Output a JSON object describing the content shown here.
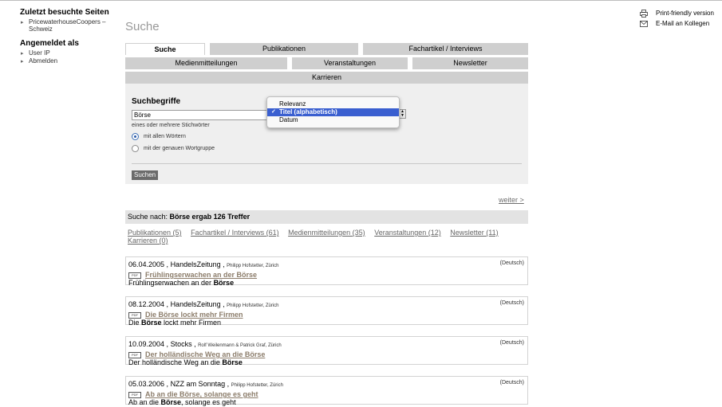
{
  "sidebar": {
    "recent_heading": "Zuletzt besuchte Seiten",
    "recent_items": [
      {
        "label": "PricewaterhouseCoopers –",
        "sub": "Schweiz"
      }
    ],
    "account_heading": "Angemeldet als",
    "account_items": [
      {
        "label": "User IP"
      },
      {
        "label": "Abmelden"
      }
    ]
  },
  "utility": {
    "print_label": "Print-friendly version",
    "email_label": "E-Mail an Kollegen",
    "print_icon": "printer-icon",
    "email_icon": "envelope-icon"
  },
  "page": {
    "title": "Suche"
  },
  "tabs": {
    "row1": [
      "Suche",
      "Publikationen",
      "Fachartikel / Interviews"
    ],
    "row2": [
      "Medienmitteilungen",
      "Veranstaltungen",
      "Newsletter"
    ],
    "row3": [
      "Karrieren"
    ],
    "active": "Suche"
  },
  "search": {
    "label": "Suchbegriffe",
    "query": "Börse",
    "help": "eines oder mehrere Stichwörter",
    "options": [
      "mit allen Wörtern",
      "mit der genauen Wortgruppe"
    ],
    "selected_option": "mit allen Wörtern",
    "button": "Suchen"
  },
  "sort": {
    "options": [
      "Relevanz",
      "Titel (alphabetisch)",
      "Datum"
    ],
    "selected": "Titel (alphabetisch)",
    "check": "✓"
  },
  "pagination": {
    "next": "weiter >"
  },
  "results": {
    "summary_prefix": "Suche nach: ",
    "summary_bold": "Börse ergab 126 Treffer",
    "categories": [
      "Publikationen (5)",
      "Fachartikel / Interviews (61)",
      "Medienmitteilungen (35)",
      "Veranstaltungen (12)",
      "Newsletter (11)",
      "Karrieren (0)"
    ],
    "pdf_label": "PDF",
    "items": [
      {
        "date": "06.04.2005",
        "source": "HandelsZeitung",
        "author": "Philipp Hofstetter, Zürich",
        "lang": "(Deutsch)",
        "title": "Frühlingserwachen an der Börse",
        "snippet_pre": "Frühlingserwachen an der ",
        "snippet_bold": "Börse",
        "snippet_post": ""
      },
      {
        "date": "08.12.2004",
        "source": "HandelsZeitung",
        "author": "Philipp Hofstetter, Zürich",
        "lang": "(Deutsch)",
        "title": "Die Börse lockt mehr Firmen",
        "snippet_pre": "Die ",
        "snippet_bold": "Börse",
        "snippet_post": " lockt mehr Firmen"
      },
      {
        "date": "10.09.2004",
        "source": "Stocks",
        "author": "Rolf Weilenmann & Patrick Graf, Zürich",
        "lang": "(Deutsch)",
        "title": "Der holländische Weg an die Börse",
        "snippet_pre": "Der holländische Weg an die ",
        "snippet_bold": "Börse",
        "snippet_post": ""
      },
      {
        "date": "05.03.2006",
        "source": "NZZ am Sonntag",
        "author": "Philipp Hofstetter, Zürich",
        "lang": "(Deutsch)",
        "title": "Ab an die Börse, solange es geht",
        "snippet_pre": "Ab an die ",
        "snippet_bold": "Börse",
        "snippet_post": ", solange es geht"
      }
    ]
  }
}
